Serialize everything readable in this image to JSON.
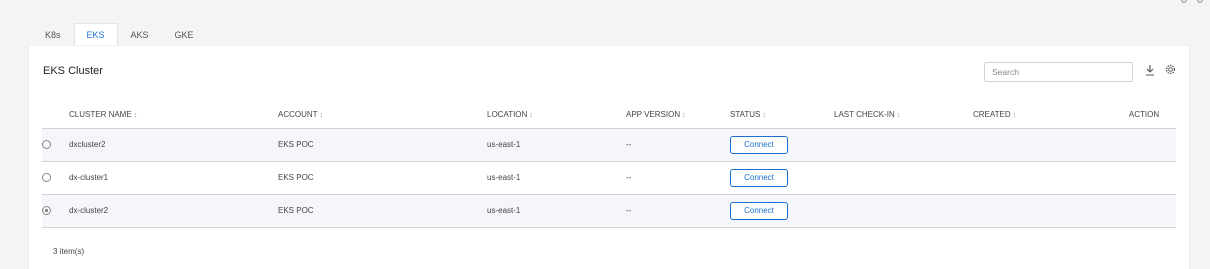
{
  "tabs": [
    {
      "label": "K8s",
      "active": false
    },
    {
      "label": "EKS",
      "active": true
    },
    {
      "label": "AKS",
      "active": false
    },
    {
      "label": "GKE",
      "active": false
    }
  ],
  "panel": {
    "title": "EKS Cluster",
    "search_placeholder": "Search",
    "item_count": "3 item(s)"
  },
  "table": {
    "columns": [
      "CLUSTER NAME",
      "ACCOUNT",
      "LOCATION",
      "APP VERSION",
      "STATUS",
      "LAST CHECK-IN",
      "CREATED",
      "ACTION"
    ],
    "sort_icon": "↕",
    "rows": [
      {
        "name": "dxcluster2",
        "account": "EKS POC",
        "location": "us-east-1",
        "app_version": "--",
        "status": "Connect",
        "last_checkin": "",
        "created": "",
        "action": "",
        "selected": false
      },
      {
        "name": "dx-cluster1",
        "account": "EKS POC",
        "location": "us-east-1",
        "app_version": "--",
        "status": "Connect",
        "last_checkin": "",
        "created": "",
        "action": "",
        "selected": false
      },
      {
        "name": "dx-cluster2",
        "account": "EKS POC",
        "location": "us-east-1",
        "app_version": "--",
        "status": "Connect",
        "last_checkin": "",
        "created": "",
        "action": "",
        "selected": true
      }
    ]
  },
  "icons": {
    "download": "download-icon",
    "settings": "gear-icon"
  },
  "colors": {
    "accent": "#1a6fcf",
    "active_tab": "#1a73d9",
    "row_alt": "#f4f6f9",
    "background": "#f3f4f6"
  }
}
